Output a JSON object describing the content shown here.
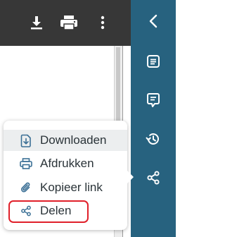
{
  "colors": {
    "toolbar": "#373737",
    "sidebar": "#27627f",
    "menu_text": "#2a3338",
    "menu_icon": "#3a6f95",
    "highlight": "#e0202a",
    "hover_row": "#eceeef"
  },
  "toolbar": {
    "buttons": [
      {
        "icon": "download-icon"
      },
      {
        "icon": "print-icon"
      },
      {
        "icon": "more-vertical-icon"
      }
    ]
  },
  "sidebar": {
    "buttons": [
      {
        "icon": "chevron-left-icon"
      },
      {
        "icon": "document-list-icon"
      },
      {
        "icon": "comment-icon"
      },
      {
        "icon": "history-icon"
      },
      {
        "icon": "share-icon"
      }
    ]
  },
  "share_menu": {
    "items": [
      {
        "label": "Downloaden",
        "icon": "download-file-icon",
        "hovered": true
      },
      {
        "label": "Afdrukken",
        "icon": "printer-icon"
      },
      {
        "label": "Kopieer link",
        "icon": "paperclip-icon"
      },
      {
        "label": "Delen",
        "icon": "share-small-icon",
        "highlighted": true
      }
    ]
  }
}
